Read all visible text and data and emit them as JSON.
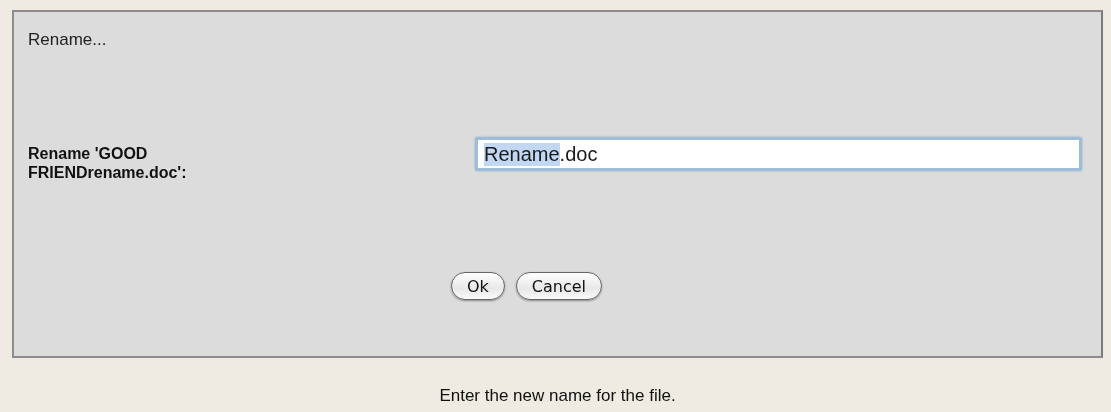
{
  "dialog": {
    "title": "Rename...",
    "label": "Rename 'GOOD FRIENDrename.doc':",
    "field": {
      "value_parts": [
        {
          "text": "Rename",
          "selected": true
        },
        {
          "text": ".doc",
          "selected": false
        }
      ]
    },
    "buttons": [
      "Ok",
      "Cancel"
    ]
  },
  "hint": "Enter the new name for the file."
}
